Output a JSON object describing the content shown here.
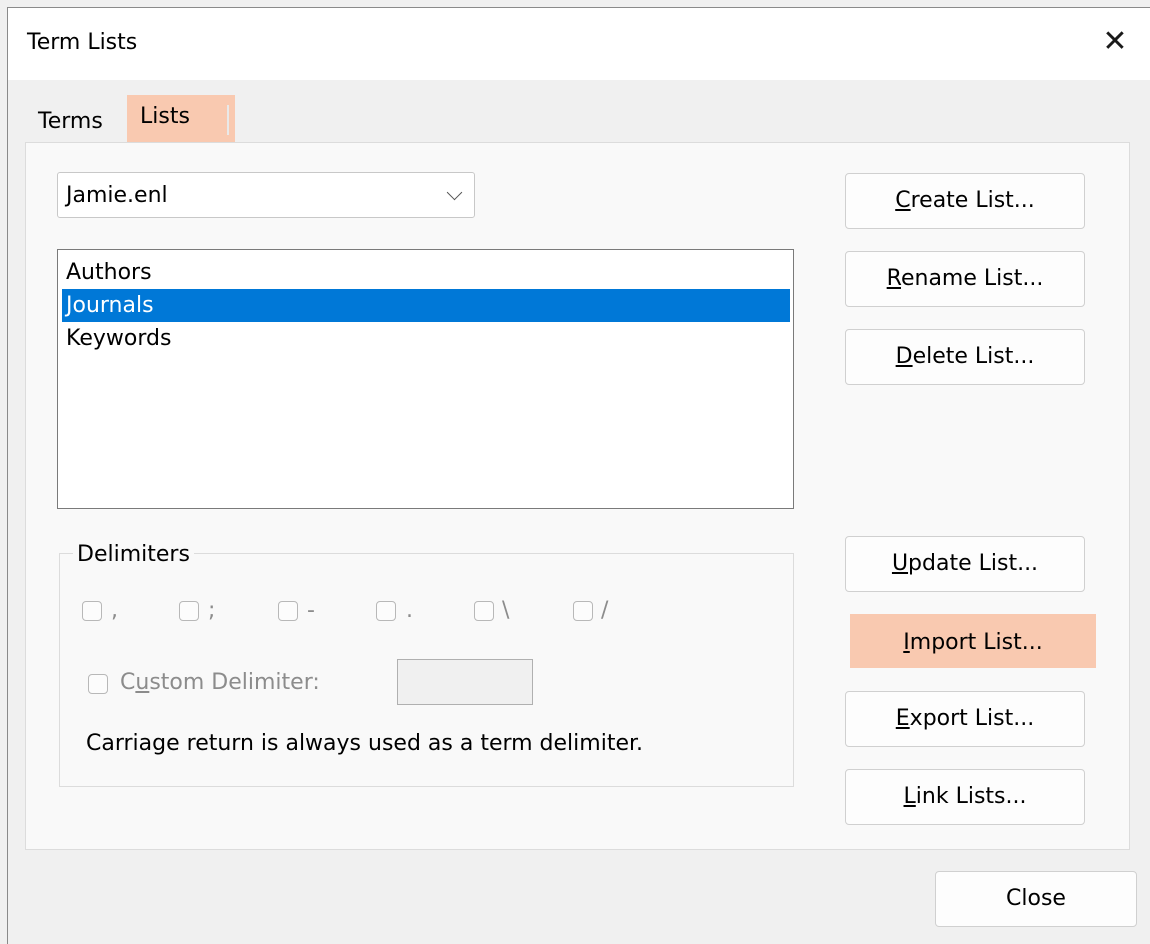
{
  "window": {
    "title": "Term Lists",
    "close_glyph": "✕"
  },
  "tabs": [
    {
      "label": "Terms"
    },
    {
      "label": "Lists",
      "highlighted": true
    }
  ],
  "database_select": {
    "value": "Jamie.enl"
  },
  "lists": [
    {
      "label": "Authors"
    },
    {
      "label": "Journals",
      "selected": true
    },
    {
      "label": "Keywords"
    }
  ],
  "delimiters": {
    "label": "Delimiters",
    "chars": [
      ",",
      ";",
      "-",
      ".",
      "\\",
      "/"
    ],
    "custom_label_pre": "C",
    "custom_label_ul": "u",
    "custom_label_post": "stom Delimiter:",
    "custom_value": "",
    "note": "Carriage return is always used as a term delimiter."
  },
  "buttons": {
    "create": {
      "ul": "C",
      "rest": "reate List..."
    },
    "rename": {
      "ul": "R",
      "rest": "ename List..."
    },
    "delete": {
      "ul": "D",
      "rest": "elete List..."
    },
    "update": {
      "ul": "U",
      "rest": "pdate List..."
    },
    "import": {
      "ul": "I",
      "rest": "mport List..."
    },
    "export": {
      "ul": "E",
      "rest": "xport List..."
    },
    "link": {
      "ul": "L",
      "rest": "ink Lists..."
    },
    "close": "Close"
  },
  "colors": {
    "highlight": "#f9c9b0",
    "selection": "#0078d7"
  }
}
